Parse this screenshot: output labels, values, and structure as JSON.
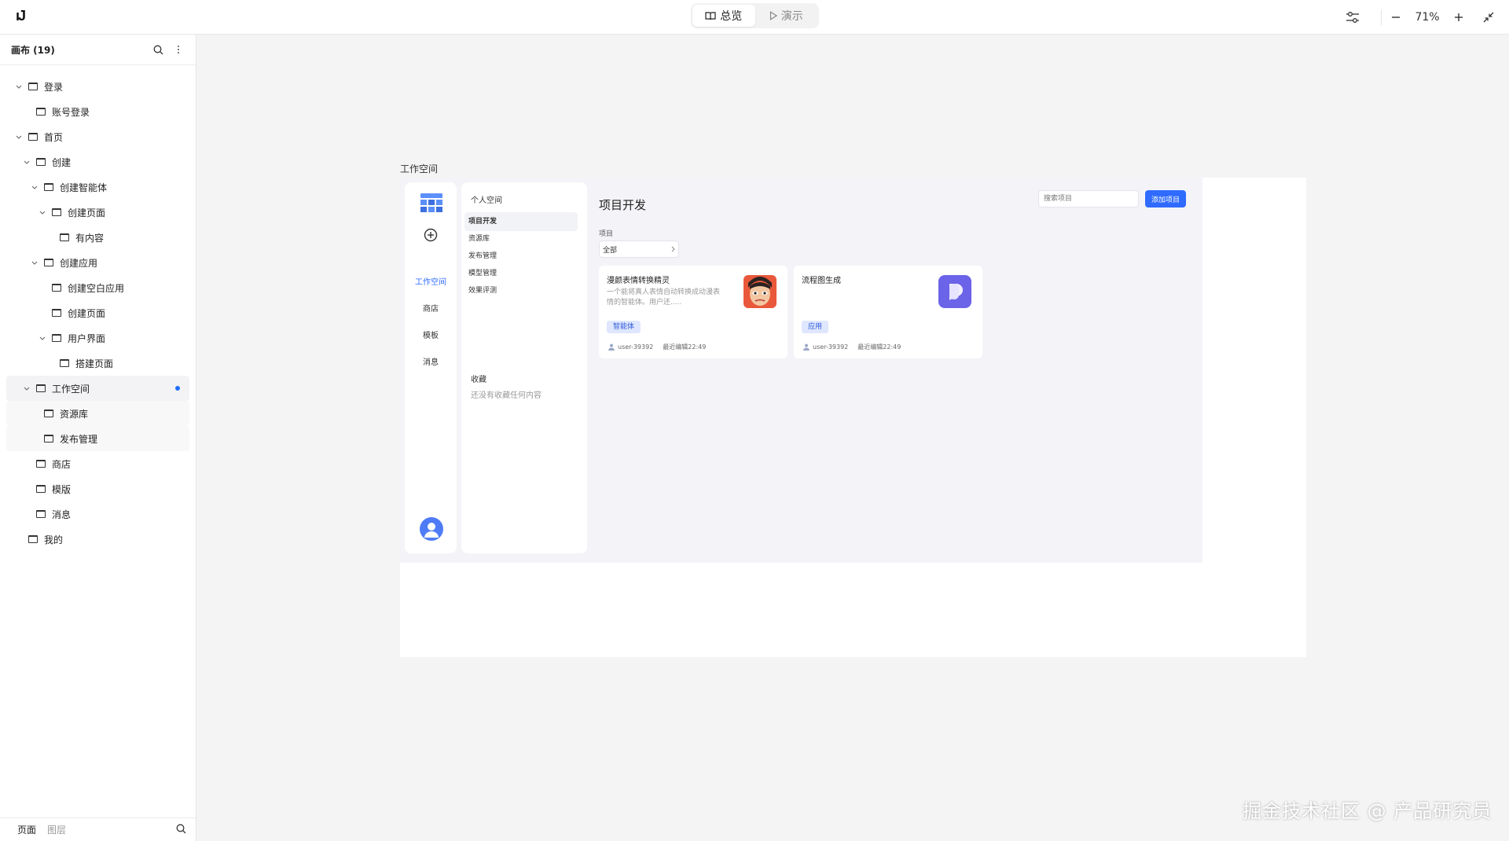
{
  "app": {
    "logo_text": "ıJ"
  },
  "toolbar": {
    "overview_label": "总览",
    "present_label": "演示",
    "zoom": "71%"
  },
  "left_panel": {
    "title": "画布 (19)",
    "tree": [
      {
        "label": "登录",
        "expanded": true
      },
      {
        "label": "账号登录"
      },
      {
        "label": "首页",
        "expanded": true
      },
      {
        "label": "创建",
        "expanded": true
      },
      {
        "label": "创建智能体",
        "expanded": true
      },
      {
        "label": "创建页面",
        "expanded": true
      },
      {
        "label": "有内容"
      },
      {
        "label": "创建应用",
        "expanded": true
      },
      {
        "label": "创建空白应用"
      },
      {
        "label": "创建页面"
      },
      {
        "label": "用户界面",
        "expanded": true
      },
      {
        "label": "搭建页面"
      },
      {
        "label": "工作空间",
        "expanded": true,
        "selected": true
      },
      {
        "label": "资源库"
      },
      {
        "label": "发布管理"
      },
      {
        "label": "商店"
      },
      {
        "label": "模版"
      },
      {
        "label": "消息"
      },
      {
        "label": "我的"
      }
    ],
    "footer": {
      "pages_tab": "页面",
      "layers_tab": "图层"
    }
  },
  "canvas": {
    "frame_label": "工作空间",
    "rail": {
      "items": [
        "工作空间",
        "商店",
        "模板",
        "消息"
      ],
      "active": "工作空间"
    },
    "subnav": {
      "title": "个人空间",
      "items": [
        "项目开发",
        "资源库",
        "发布管理",
        "模型管理",
        "效果评测"
      ],
      "active": "项目开发",
      "favorites_title": "收藏",
      "favorites_empty": "还没有收藏任何内容"
    },
    "main": {
      "title": "项目开发",
      "search_placeholder": "搜索项目",
      "add_button": "添加项目",
      "filter_label": "项目",
      "filter_value": "全部",
      "cards": [
        {
          "title": "漫颜表情转换精灵",
          "description": "一个能将真人表情自动转换成动漫表情的智能体。用户还.....",
          "tag": "智能体",
          "user": "user-39392",
          "edited": "最近编辑22:49"
        },
        {
          "title": "流程图生成",
          "description": "",
          "tag": "应用",
          "user": "user-39392",
          "edited": "最近编辑22:49"
        }
      ]
    }
  },
  "watermark": "掘金技术社区 @ 产品研究员",
  "colors": {
    "accent": "#2f6bff",
    "tag_bg": "#dfe7ff",
    "selected_dot": "#1f6fff"
  }
}
